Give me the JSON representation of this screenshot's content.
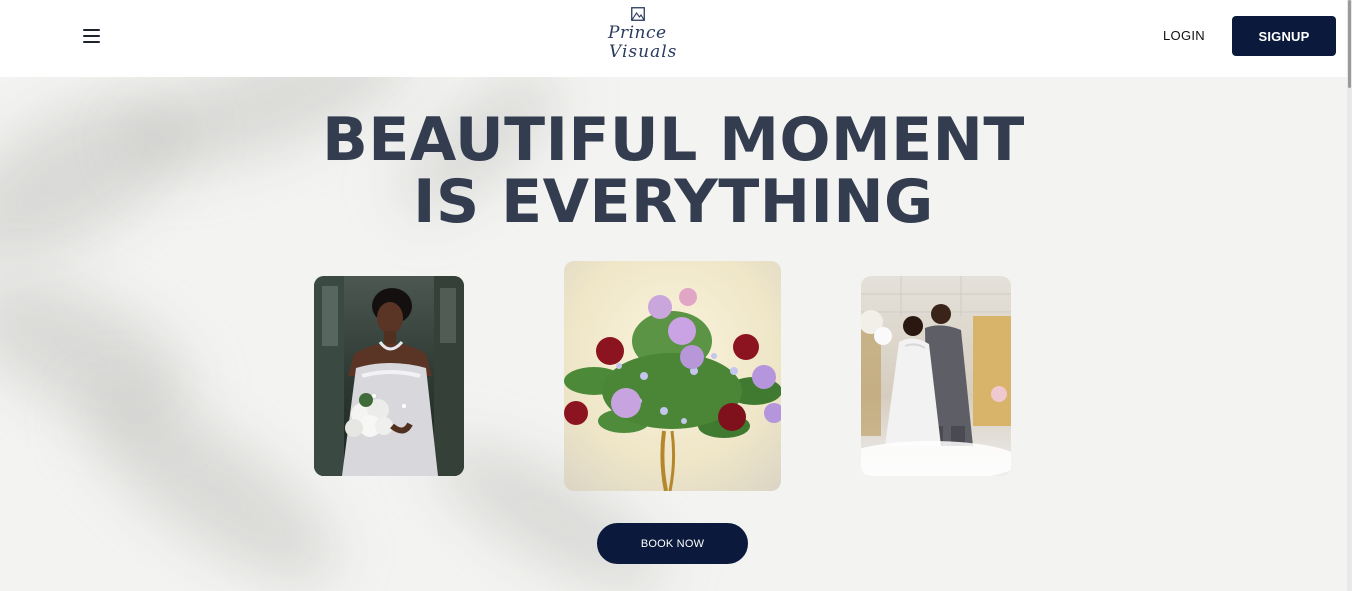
{
  "header": {
    "menu_icon": "hamburger-menu-icon",
    "logo": {
      "line1": "Prince",
      "line2": "Visuals",
      "mark_icon": "frame-logo-icon"
    },
    "login_label": "LOGIN",
    "signup_label": "SIGNUP"
  },
  "hero": {
    "title_line1": "BEAUTIFUL MOMENT",
    "title_line2": "IS EVERYTHING",
    "photos": [
      {
        "name": "bride-photo",
        "subject": "bride with white bouquet"
      },
      {
        "name": "flower-centerpiece-photo",
        "subject": "rose centerpiece"
      },
      {
        "name": "couple-photo",
        "subject": "bride and groom dancing"
      }
    ],
    "book_label": "BOOK NOW"
  },
  "colors": {
    "brand_navy": "#0b1a3c",
    "title_text": "#333d4f",
    "background": "#f3f3f1",
    "header_bg": "#ffffff"
  }
}
